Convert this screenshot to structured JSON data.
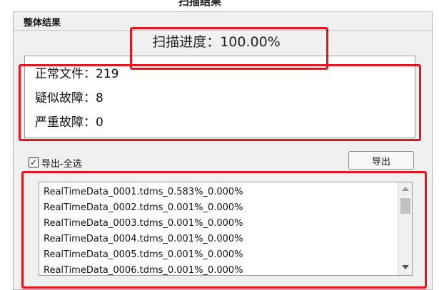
{
  "window": {
    "title": "扫描结果"
  },
  "panel": {
    "header": "整体结果",
    "progress_text": "扫描进度：100.00%"
  },
  "stats": [
    {
      "label": "正常文件：219"
    },
    {
      "label": "疑似故障：8"
    },
    {
      "label": "严重故障：0"
    }
  ],
  "export": {
    "select_all_label": "导出-全选",
    "select_all_checked": true,
    "button_label": "导出"
  },
  "file_list": [
    "RealTimeData_0001.tdms_0.583%_0.000%",
    "RealTimeData_0002.tdms_0.001%_0.000%",
    "RealTimeData_0003.tdms_0.001%_0.000%",
    "RealTimeData_0004.tdms_0.001%_0.000%",
    "RealTimeData_0005.tdms_0.001%_0.000%",
    "RealTimeData_0006.tdms_0.001%_0.000%"
  ],
  "colors": {
    "highlight": "#e8141c",
    "panel_bg": "#f0f0f0"
  },
  "icons": [
    "checkmark-icon",
    "scroll-up-arrow-icon",
    "scroll-down-arrow-icon"
  ]
}
